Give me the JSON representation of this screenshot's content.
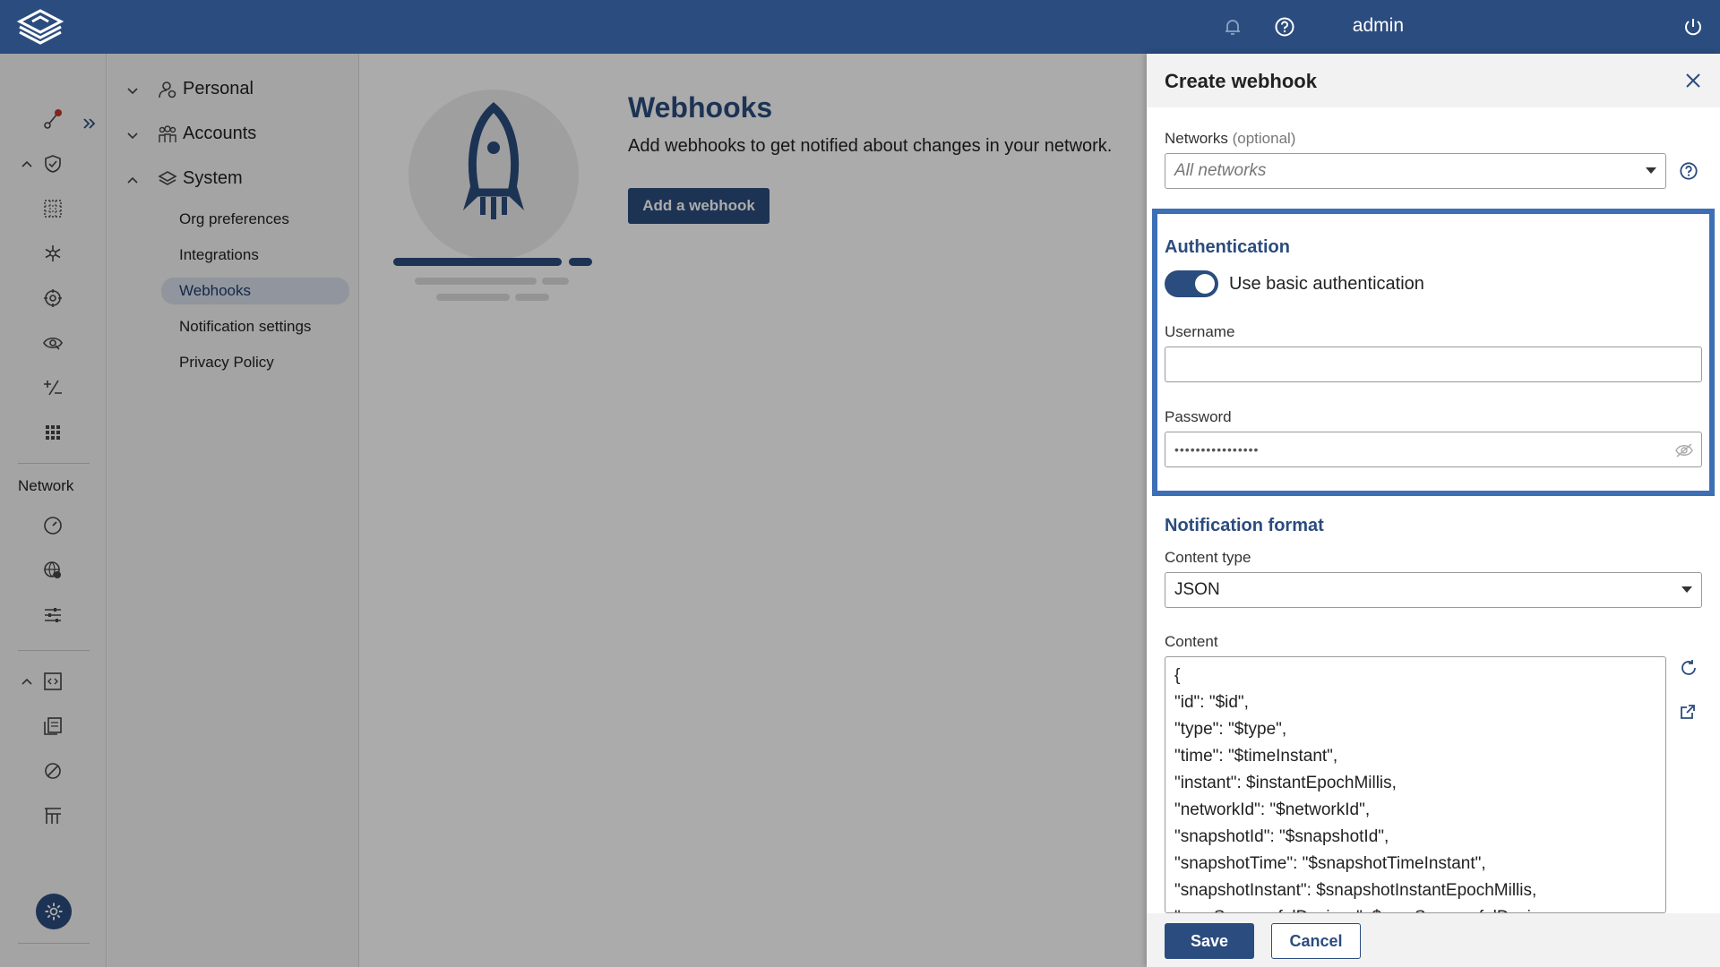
{
  "topbar": {
    "user_label": "admin",
    "icons": [
      "logo-icon",
      "bell-icon",
      "help-icon",
      "power-icon"
    ]
  },
  "rail": {
    "network_label": "Network",
    "badge_color": "#c0392b"
  },
  "subnav": {
    "groups": [
      {
        "label": "Personal"
      },
      {
        "label": "Accounts"
      },
      {
        "label": "System"
      }
    ],
    "system_items": [
      {
        "label": "Org preferences"
      },
      {
        "label": "Integrations"
      },
      {
        "label": "Webhooks"
      },
      {
        "label": "Notification settings"
      },
      {
        "label": "Privacy Policy"
      }
    ]
  },
  "main": {
    "title": "Webhooks",
    "description": "Add webhooks to get notified about changes in your network.",
    "add_button": "Add a webhook"
  },
  "drawer": {
    "title": "Create webhook",
    "networks_label": "Networks",
    "networks_optional": "(optional)",
    "networks_value": "All networks",
    "auth_title": "Authentication",
    "toggle_label": "Use basic authentication",
    "toggle_on": true,
    "username_label": "Username",
    "username_value": "",
    "password_label": "Password",
    "password_value": "••••••••••••••••",
    "format_title": "Notification format",
    "content_type_label": "Content type",
    "content_type_value": "JSON",
    "content_label": "Content",
    "content_lines": [
      "{",
      "\"id\": \"$id\",",
      "\"type\": \"$type\",",
      "\"time\": \"$timeInstant\",",
      "\"instant\": $instantEpochMillis,",
      "\"networkId\": \"$networkId\",",
      "\"snapshotId\": \"$snapshotId\",",
      "\"snapshotTime\": \"$snapshotTimeInstant\",",
      "\"snapshotInstant\": $snapshotInstantEpochMillis,",
      "\"numSuccessfulDevices\": $numSuccessfulDevices,"
    ],
    "save_label": "Save",
    "cancel_label": "Cancel"
  },
  "colors": {
    "brand": "#2b4c7e",
    "highlight_border": "#3d6fb6",
    "active_nav": "#d8deea"
  }
}
